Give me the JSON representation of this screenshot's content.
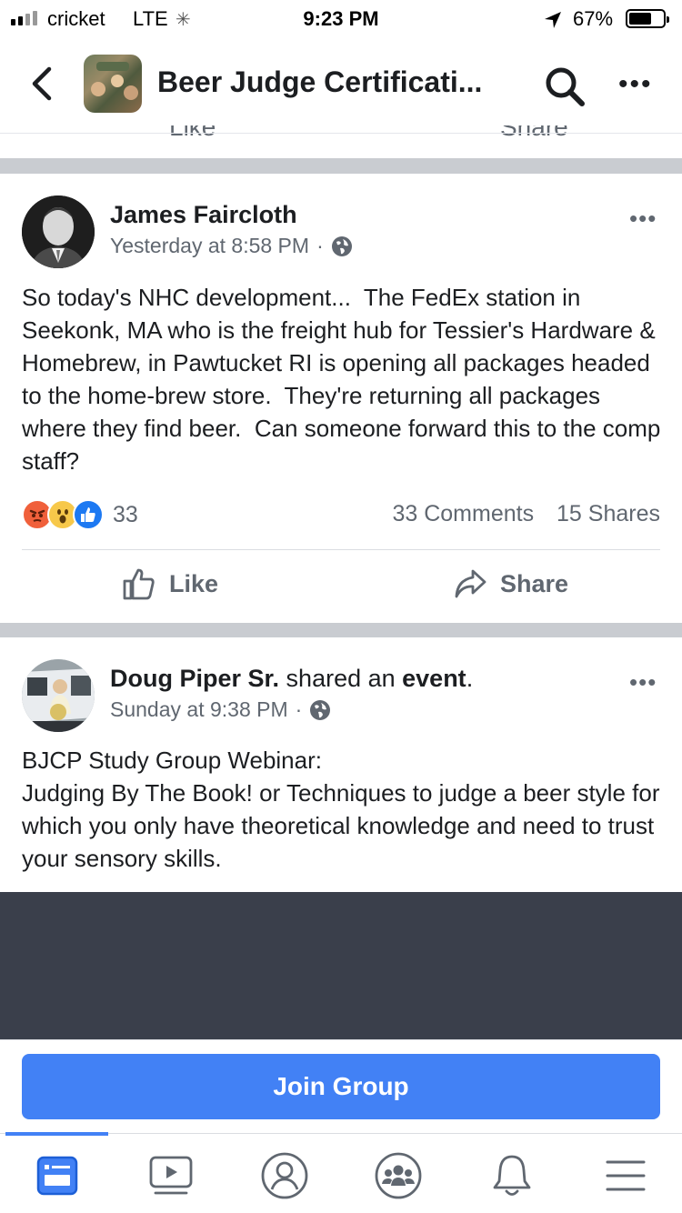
{
  "status": {
    "carrier": "cricket",
    "network": "LTE",
    "time": "9:23 PM",
    "battery_pct": "67%",
    "battery_level": 0.67,
    "icons": [
      "signal-icon",
      "loading-icon",
      "location-arrow-icon",
      "battery-icon"
    ]
  },
  "nav": {
    "title": "Beer Judge Certificati...",
    "icons": [
      "back-icon",
      "search-icon",
      "more-icon"
    ]
  },
  "feed": {
    "cutoff_actions": {
      "like": "Like",
      "share": "Share"
    }
  },
  "posts": [
    {
      "author": "James Faircloth",
      "time": "Yesterday at 8:58 PM",
      "privacy": "globe-icon",
      "body": "So today's NHC development...  The FedEx station in Seekonk, MA who is the freight hub for Tessier's Hardware & Homebrew, in Pawtucket RI is opening all packages headed to the home-brew store.  They're returning all packages where they find beer.  Can someone forward this to the comp staff?",
      "reactions": [
        "angry",
        "wow",
        "like"
      ],
      "reaction_count": "33",
      "comments": "33 Comments",
      "shares": "15 Shares",
      "like_label": "Like",
      "share_label": "Share"
    },
    {
      "author": "Doug Piper Sr.",
      "action_text": " shared an ",
      "action_object": "event",
      "action_end": ".",
      "time": "Sunday at 9:38 PM",
      "privacy": "globe-icon",
      "body": "BJCP Study Group Webinar:\nJudging By The Book! or Techniques to judge a beer style for which you only have theoretical knowledge and need to trust your sensory skills."
    }
  ],
  "join_button": "Join Group",
  "colors": {
    "accent": "#4281f5",
    "separator": "#c9ccd1",
    "event_bg": "#3a3f4b",
    "secondary_text": "#606770"
  },
  "tabbar": {
    "tabs": [
      "feed-icon",
      "watch-icon",
      "profile-icon",
      "groups-icon",
      "notifications-icon",
      "menu-icon"
    ],
    "active": "feed-icon"
  }
}
